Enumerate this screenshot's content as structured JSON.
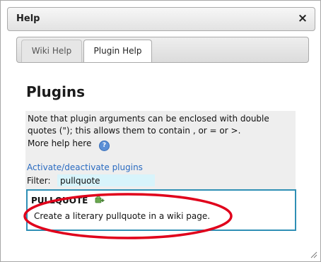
{
  "dialog": {
    "title": "Help",
    "close_symbol": "×"
  },
  "tabs": [
    {
      "label": "Wiki Help",
      "active": false
    },
    {
      "label": "Plugin Help",
      "active": true
    }
  ],
  "content": {
    "heading": "Plugins",
    "note": "Note that plugin arguments can be enclosed with double quotes (\"); this allows them to contain , or = or >.",
    "more_help": "More help here",
    "help_icon": "question-circle-icon",
    "activate_link": "Activate/deactivate plugins",
    "filter": {
      "label": "Filter:",
      "value": "pullquote"
    }
  },
  "plugin": {
    "name": "PULLQUOTE",
    "add_icon": "plugin-add-icon",
    "description": "Create a literary pullquote in a wiki page."
  },
  "colors": {
    "link": "#2a6bc1",
    "filter_bg": "#d8f4fb",
    "plugin_border": "#2f8fb5",
    "annotation": "#e0001b"
  }
}
